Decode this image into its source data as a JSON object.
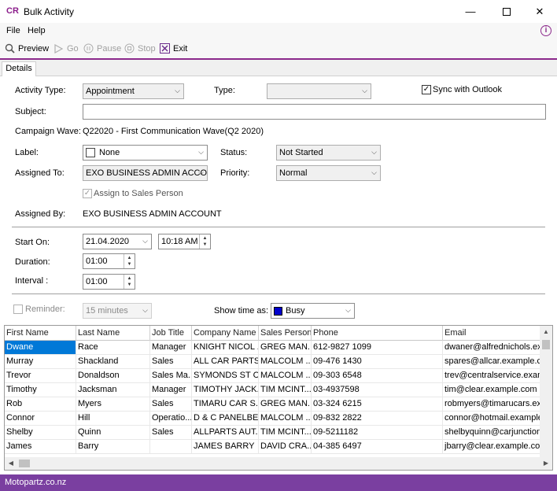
{
  "window": {
    "logo": "CR",
    "title": "Bulk Activity",
    "minimize_icon": "minimize-icon",
    "maximize_icon": "maximize-icon",
    "close_icon": "close-icon"
  },
  "menu": {
    "file": "File",
    "help": "Help",
    "info_icon": "info-icon"
  },
  "toolbar": {
    "preview": "Preview",
    "go": "Go",
    "pause": "Pause",
    "stop": "Stop",
    "exit": "Exit"
  },
  "tabs": {
    "details": "Details"
  },
  "form": {
    "activity_type_label": "Activity Type:",
    "activity_type_value": "Appointment",
    "type_label": "Type:",
    "type_value": "",
    "sync_label": "Sync with Outlook",
    "sync_checked": true,
    "subject_label": "Subject:",
    "subject_value": "",
    "campaign_wave_label": "Campaign Wave:",
    "campaign_wave_value": "Q22020 - First Communication Wave(Q2 2020)",
    "label_label": "Label:",
    "label_value": "None",
    "status_label": "Status:",
    "status_value": "Not Started",
    "assigned_to_label": "Assigned To:",
    "assigned_to_value": "EXO BUSINESS ADMIN ACCO",
    "priority_label": "Priority:",
    "priority_value": "Normal",
    "assign_sales_label": "Assign to Sales Person",
    "assign_sales_checked": true,
    "assigned_by_label": "Assigned By:",
    "assigned_by_value": "EXO BUSINESS ADMIN ACCOUNT",
    "start_on_label": "Start On:",
    "start_date": "21.04.2020",
    "start_time": "10:18 AM",
    "duration_label": "Duration:",
    "duration_value": "01:00",
    "interval_label": "Interval :",
    "interval_value": "01:00",
    "reminder_label": "Reminder:",
    "reminder_checked": false,
    "reminder_value": "15 minutes",
    "show_time_label": "Show time as:",
    "show_time_value": "Busy",
    "busy_color": "#0000cc"
  },
  "grid": {
    "columns": [
      "First Name",
      "Last Name",
      "Job Title",
      "Company Name",
      "Sales Person",
      "Phone",
      "Email"
    ],
    "rows": [
      [
        "Dwane",
        "Race",
        "Manager",
        "KNIGHT NICOL ...",
        "GREG MAN...",
        "612-9827 1099",
        "dwaner@alfrednichols.exa"
      ],
      [
        "Murray",
        "Shackland",
        "Sales",
        "ALL CAR PARTS",
        "MALCOLM ...",
        "09-476 1430",
        "spares@allcar.example.co"
      ],
      [
        "Trevor",
        "Donaldson",
        "Sales Ma...",
        "SYMONDS ST C...",
        "MALCOLM ...",
        "09-303 6548",
        "trev@centralservice.examp"
      ],
      [
        "Timothy",
        "Jacksman",
        "Manager",
        "TIMOTHY JACK...",
        "TIM MCINT...",
        "03-4937598",
        "tim@clear.example.com"
      ],
      [
        "Rob",
        "Myers",
        "Sales",
        "TIMARU CAR S...",
        "GREG MAN...",
        "03-324 6215",
        "robmyers@timarucars.exa"
      ],
      [
        "Connor",
        "Hill",
        "Operatio...",
        "D & C PANELBE...",
        "MALCOLM ...",
        "09-832 2822",
        "connor@hotmail.example"
      ],
      [
        "Shelby",
        "Quinn",
        "Sales",
        "ALLPARTS AUT...",
        "TIM MCINT...",
        "09-5211182",
        "shelbyquinn@carjunction"
      ],
      [
        "James",
        "Barry",
        "",
        "JAMES BARRY",
        "DAVID CRA...",
        "04-385 6497",
        "jbarry@clear.example.com"
      ]
    ],
    "selected_cell": "Dwane"
  },
  "status": {
    "text": "Motopartz.co.nz",
    "color": "#7a3fa0"
  }
}
